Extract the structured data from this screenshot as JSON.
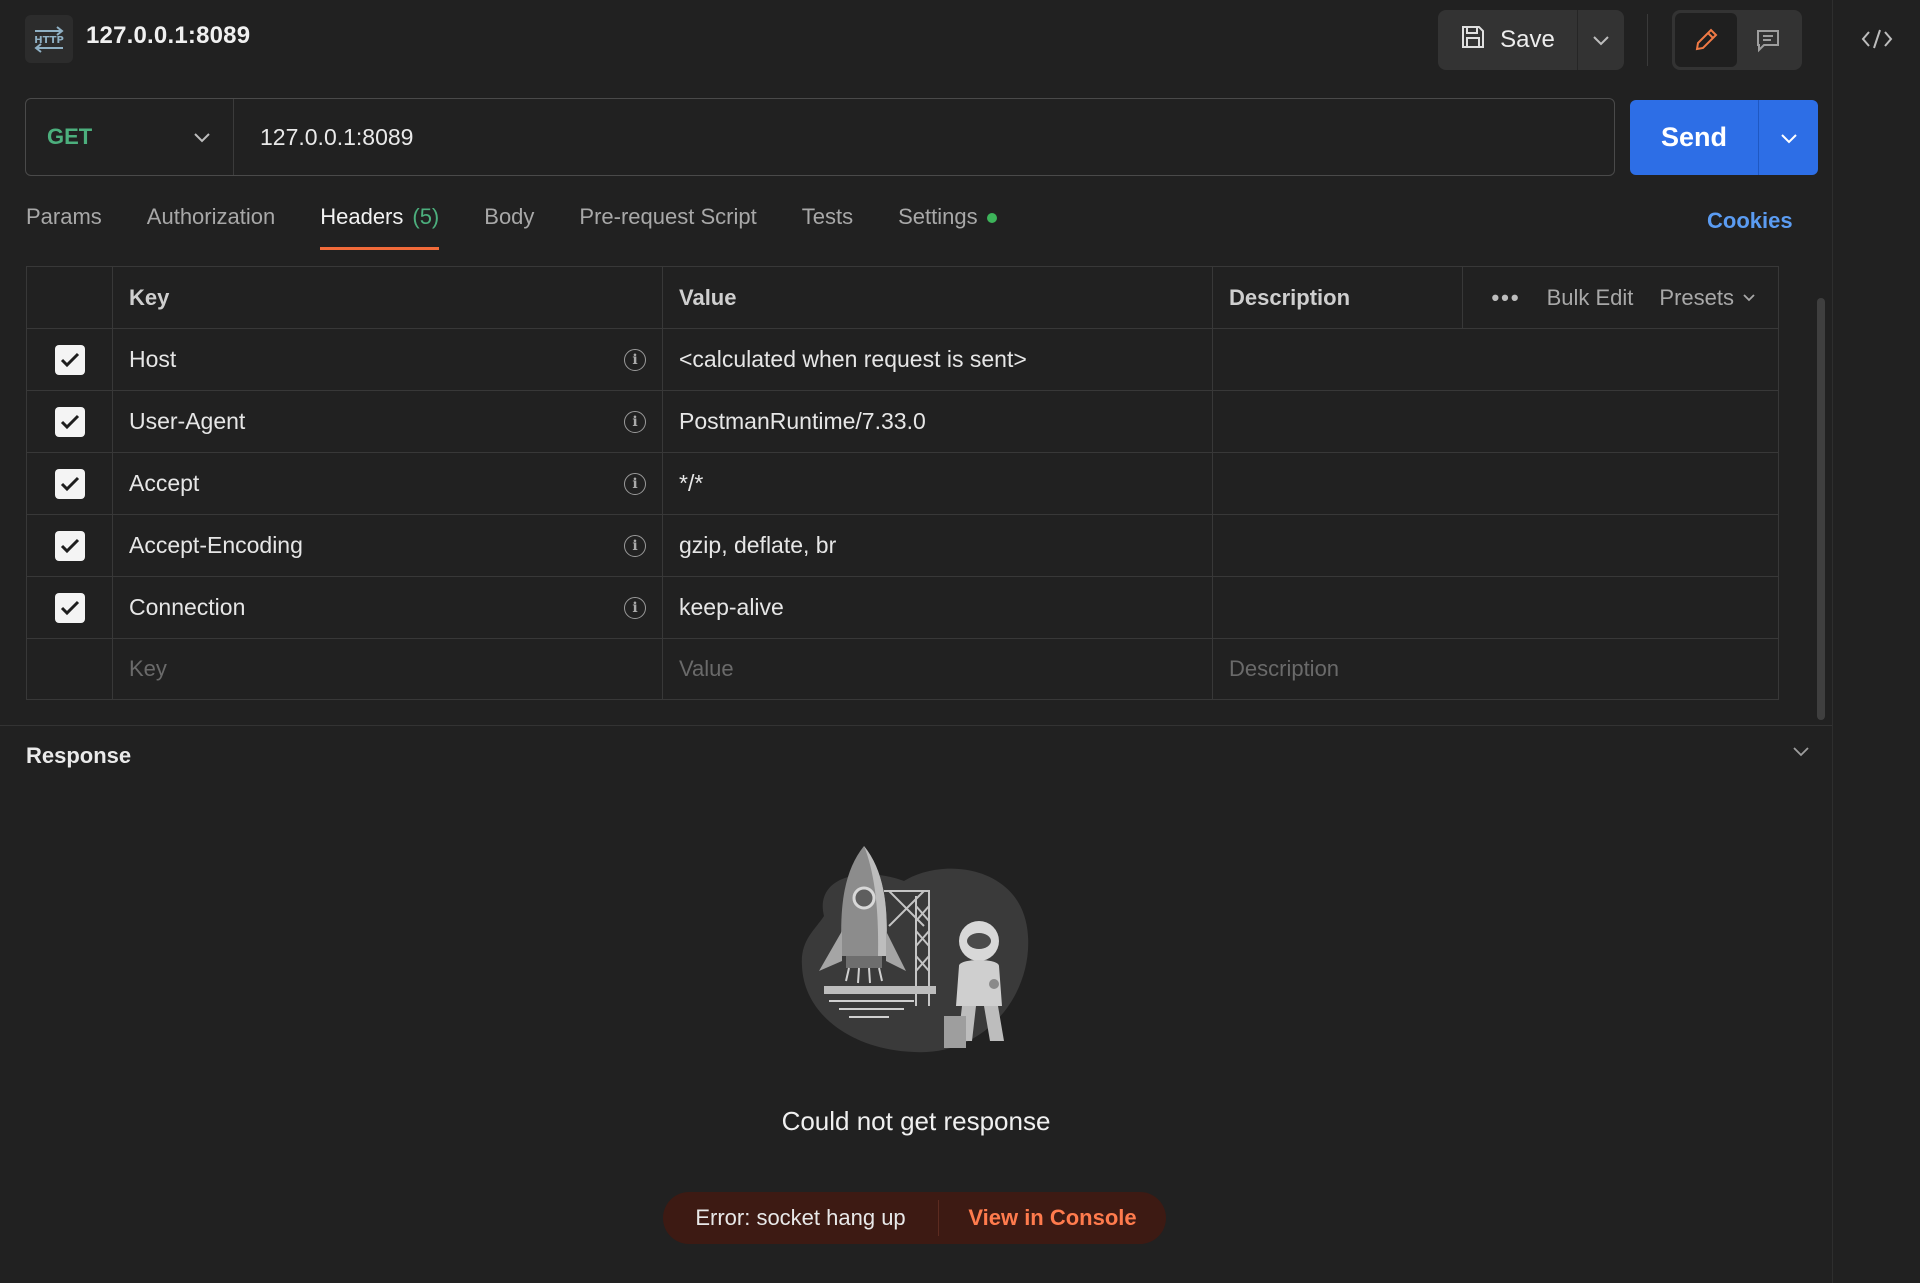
{
  "request": {
    "icon_label": "HTTP",
    "title": "127.0.0.1:8089",
    "method": "GET",
    "url": "127.0.0.1:8089"
  },
  "toolbar": {
    "save_label": "Save",
    "send_label": "Send"
  },
  "tabs": [
    {
      "label": "Params"
    },
    {
      "label": "Authorization"
    },
    {
      "label": "Headers",
      "count": "(5)"
    },
    {
      "label": "Body"
    },
    {
      "label": "Pre-request Script"
    },
    {
      "label": "Tests"
    },
    {
      "label": "Settings"
    }
  ],
  "cookies_label": "Cookies",
  "headers_table": {
    "columns": {
      "key": "Key",
      "value": "Value",
      "description": "Description"
    },
    "actions": {
      "bulk_edit": "Bulk Edit",
      "presets": "Presets"
    },
    "rows": [
      {
        "key": "Host",
        "value": "<calculated when request is sent>",
        "checked": true
      },
      {
        "key": "User-Agent",
        "value": "PostmanRuntime/7.33.0",
        "checked": true
      },
      {
        "key": "Accept",
        "value": "*/*",
        "checked": true
      },
      {
        "key": "Accept-Encoding",
        "value": "gzip, deflate, br",
        "checked": true
      },
      {
        "key": "Connection",
        "value": "keep-alive",
        "checked": true
      }
    ],
    "placeholders": {
      "key": "Key",
      "value": "Value",
      "description": "Description"
    }
  },
  "response": {
    "title": "Response",
    "message": "Could not get response",
    "error": "Error: socket hang up",
    "console_link": "View in Console"
  },
  "colors": {
    "background": "#212121",
    "method_get": "#4caf7d",
    "send_button": "#2d6ee6",
    "active_tab_underline": "#f26b3a",
    "cookies_link": "#5b9cf2",
    "error_link": "#ff7b4d"
  }
}
